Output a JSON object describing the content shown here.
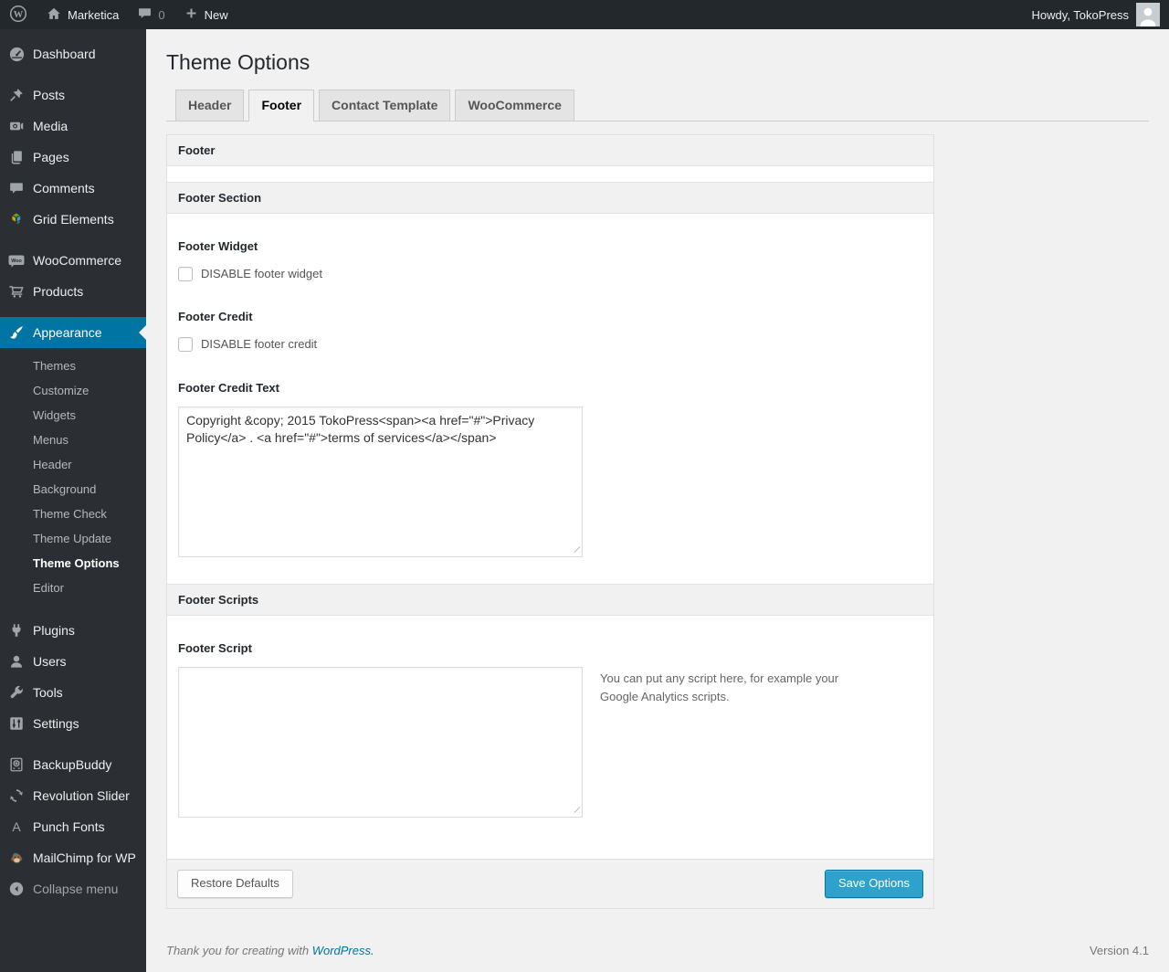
{
  "admin_bar": {
    "wp_logo": "wordpress-logo",
    "site_name": "Marketica",
    "comment_count": "0",
    "new_label": "New",
    "howdy_text": "Howdy, TokoPress"
  },
  "sidebar": {
    "items": [
      {
        "label": "Dashboard",
        "icon": "dashboard-gauge-icon"
      },
      {
        "label": "Posts",
        "icon": "pushpin-icon"
      },
      {
        "label": "Media",
        "icon": "media-camera-icon"
      },
      {
        "label": "Pages",
        "icon": "pages-icon"
      },
      {
        "label": "Comments",
        "icon": "comment-bubble-icon"
      },
      {
        "label": "Grid Elements",
        "icon": "grid-elements-icon"
      },
      {
        "label": "WooCommerce",
        "icon": "woocommerce-badge-icon"
      },
      {
        "label": "Products",
        "icon": "cart-icon"
      },
      {
        "label": "Appearance",
        "icon": "brush-icon",
        "active": true
      },
      {
        "label": "Plugins",
        "icon": "plug-icon"
      },
      {
        "label": "Users",
        "icon": "user-icon"
      },
      {
        "label": "Tools",
        "icon": "wrench-icon"
      },
      {
        "label": "Settings",
        "icon": "sliders-icon"
      },
      {
        "label": "BackupBuddy",
        "icon": "backup-drive-icon"
      },
      {
        "label": "Revolution Slider",
        "icon": "refresh-cycle-icon"
      },
      {
        "label": "Punch Fonts",
        "icon": "letter-a-icon"
      },
      {
        "label": "MailChimp for WP",
        "icon": "mailchimp-monkey-icon"
      }
    ],
    "appearance_submenu": [
      "Themes",
      "Customize",
      "Widgets",
      "Menus",
      "Header",
      "Background",
      "Theme Check",
      "Theme Update",
      "Theme Options",
      "Editor"
    ],
    "current_submenu_item": "Theme Options",
    "collapse_label": "Collapse menu"
  },
  "page": {
    "title": "Theme Options",
    "tabs": [
      {
        "label": "Header",
        "active": false
      },
      {
        "label": "Footer",
        "active": true
      },
      {
        "label": "Contact Template",
        "active": false
      },
      {
        "label": "WooCommerce",
        "active": false
      }
    ]
  },
  "panel": {
    "group_header": "Footer",
    "section_footer": {
      "title": "Footer Section",
      "footer_widget": {
        "label": "Footer Widget",
        "checkbox_label": "DISABLE footer widget",
        "checked": false
      },
      "footer_credit": {
        "label": "Footer Credit",
        "checkbox_label": "DISABLE footer credit",
        "checked": false
      },
      "footer_credit_text": {
        "label": "Footer Credit Text",
        "value": "Copyright &copy; 2015 TokoPress<span><a href=\"#\">Privacy Policy</a> . <a href=\"#\">terms of services</a></span>"
      }
    },
    "section_scripts": {
      "title": "Footer Scripts",
      "footer_script": {
        "label": "Footer Script",
        "value": "",
        "help": "You can put any script here, for example your Google Analytics scripts."
      }
    },
    "buttons": {
      "restore": "Restore Defaults",
      "save": "Save Options"
    }
  },
  "footer": {
    "thanks_prefix": "Thank you for creating with ",
    "wordpress_link": "WordPress.",
    "version": "Version 4.1"
  },
  "colors": {
    "menu_highlight": "#0074a2",
    "primary_button": "#2ea2cc",
    "link": "#0074a2",
    "admin_bar_bg": "#23282d",
    "sidebar_bg": "#2b2e33"
  }
}
